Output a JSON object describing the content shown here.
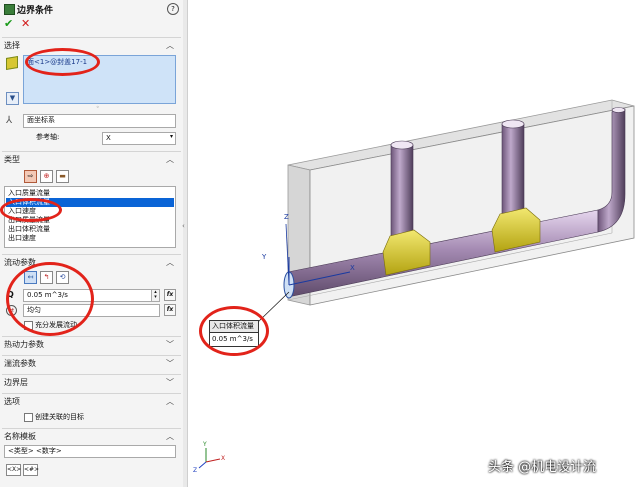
{
  "panel": {
    "title": "边界条件",
    "help_icon": "question-icon",
    "ok_icon": "checkmark-icon",
    "cancel_icon": "close-icon",
    "selection": {
      "header": "选择",
      "selected_face": "面<1>@封盖17-1",
      "coord_system": "面坐标系",
      "reference_axis_label": "参考轴:",
      "reference_axis_value": "X"
    },
    "type": {
      "header": "类型",
      "items": [
        "入口质量流量",
        "入口体积流量",
        "入口速度",
        "出口质量流量",
        "出口体积流量",
        "出口速度"
      ],
      "selected_index": 1
    },
    "flow": {
      "header": "流动参数",
      "q_label": "Q",
      "q_value": "0.05 m^3/s",
      "profile_value": "均匀",
      "fully_developed_label": "充分发展流动"
    },
    "sections": {
      "thermo": "热动力参数",
      "turbulence": "湍流参数",
      "boundary_layer": "边界层",
      "options": "选项",
      "create_target": "创建关联的目标",
      "name_template": "名称模板",
      "template_value": "<类型> <数字>",
      "tag_type": "<X>",
      "tag_num": "<#>"
    }
  },
  "viewport": {
    "callout_title": "入口体积流量",
    "callout_value": "0.05 m^3/s",
    "axis_y": "Y",
    "axis_z": "Z",
    "axis_x": "X",
    "triad_y": "Y",
    "triad_z": "Z",
    "triad_x": "X",
    "watermark": "头条 @机电设计流"
  },
  "colors": {
    "selection_highlight": "#0a64d6",
    "annotation_red": "#e2231a",
    "pipe_purple": "#8a6c96",
    "junction_yellow": "#e2d21e"
  }
}
